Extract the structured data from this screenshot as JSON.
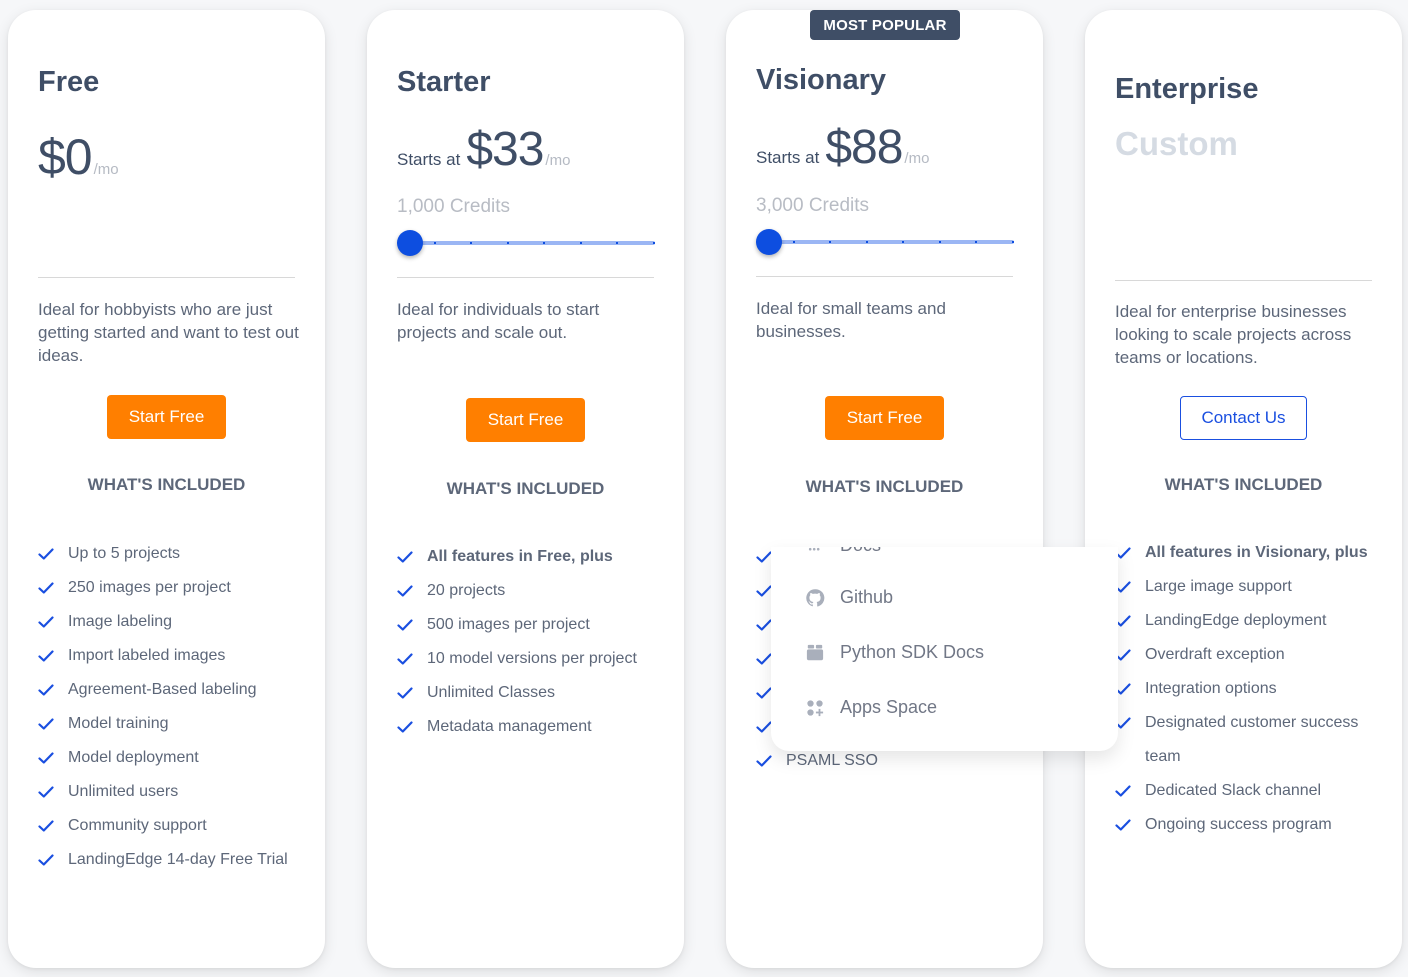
{
  "plans": [
    {
      "name": "Free",
      "price_prefix": "",
      "price": "$0",
      "price_suffix": "/mo",
      "credits": "",
      "slider_value": null,
      "description": "Ideal for hobbyists who are just getting started and want to test out ideas.",
      "cta": "Start Free",
      "included_heading": "WHAT'S INCLUDED",
      "features": [
        {
          "text": "Up to 5 projects",
          "bold": false
        },
        {
          "text": "250 images per project",
          "bold": false
        },
        {
          "text": "Image labeling",
          "bold": false
        },
        {
          "text": "Import labeled images",
          "bold": false
        },
        {
          "text": "Agreement-Based labeling",
          "bold": false
        },
        {
          "text": "Model training",
          "bold": false
        },
        {
          "text": "Model deployment",
          "bold": false
        },
        {
          "text": "Unlimited users",
          "bold": false
        },
        {
          "text": "Community support",
          "bold": false
        },
        {
          "text": "LandingEdge 14-day Free Trial",
          "bold": false
        }
      ]
    },
    {
      "name": "Starter",
      "price_prefix": "Starts at",
      "price": "$33",
      "price_suffix": "/mo",
      "credits": "1,000 Credits",
      "slider_value": 0,
      "slider_steps": 8,
      "description": "Ideal for individuals to start projects and scale out.",
      "cta": "Start Free",
      "included_heading": "WHAT'S INCLUDED",
      "features": [
        {
          "text": "All features in Free, plus",
          "bold": true
        },
        {
          "text": "20 projects",
          "bold": false
        },
        {
          "text": "500 images per project",
          "bold": false
        },
        {
          "text": "10 model versions per project",
          "bold": false
        },
        {
          "text": "Unlimited Classes",
          "bold": false
        },
        {
          "text": "Metadata management",
          "bold": false
        }
      ]
    },
    {
      "name": "Visionary",
      "badge": "MOST POPULAR",
      "price_prefix": "Starts at",
      "price": "$88",
      "price_suffix": "/mo",
      "credits": "3,000 Credits",
      "slider_value": 0,
      "slider_steps": 8,
      "description": "Ideal for small teams and businesses.",
      "cta": "Start Free",
      "included_heading": "WHAT'S INCLUDED",
      "features": [
        {
          "text": "",
          "bold": false
        },
        {
          "text": "",
          "bold": false
        },
        {
          "text": "",
          "bold": false
        },
        {
          "text": "",
          "bold": false
        },
        {
          "text": "",
          "bold": false
        },
        {
          "text": "",
          "bold": false
        },
        {
          "text": "PSAML SSO",
          "bold": false
        }
      ]
    },
    {
      "name": "Enterprise",
      "price_custom": "Custom",
      "description": "Ideal for enterprise businesses looking to scale projects across teams or locations.",
      "cta": "Contact Us",
      "included_heading": "WHAT'S INCLUDED",
      "features": [
        {
          "text": "All features in Visionary, plus",
          "bold": true
        },
        {
          "text": "Large image support",
          "bold": false
        },
        {
          "text": "LandingEdge deployment",
          "bold": false
        },
        {
          "text": "Overdraft exception",
          "bold": false
        },
        {
          "text": "Integration options",
          "bold": false
        },
        {
          "text": "Designated customer success team",
          "bold": false
        },
        {
          "text": "Dedicated Slack channel",
          "bold": false
        },
        {
          "text": "Ongoing success program",
          "bold": false
        }
      ]
    }
  ],
  "dropdown": {
    "items": [
      {
        "label": "Docs",
        "icon": "docs-icon"
      },
      {
        "label": "Github",
        "icon": "github-icon"
      },
      {
        "label": "Python SDK Docs",
        "icon": "package-icon"
      },
      {
        "label": "Apps Space",
        "icon": "apps-icon"
      }
    ]
  },
  "colors": {
    "accent_orange": "#ff7f00",
    "accent_blue": "#0d4ee0",
    "heading": "#3f4e66",
    "body_text": "#5d6779",
    "muted": "#b8bcc4"
  }
}
